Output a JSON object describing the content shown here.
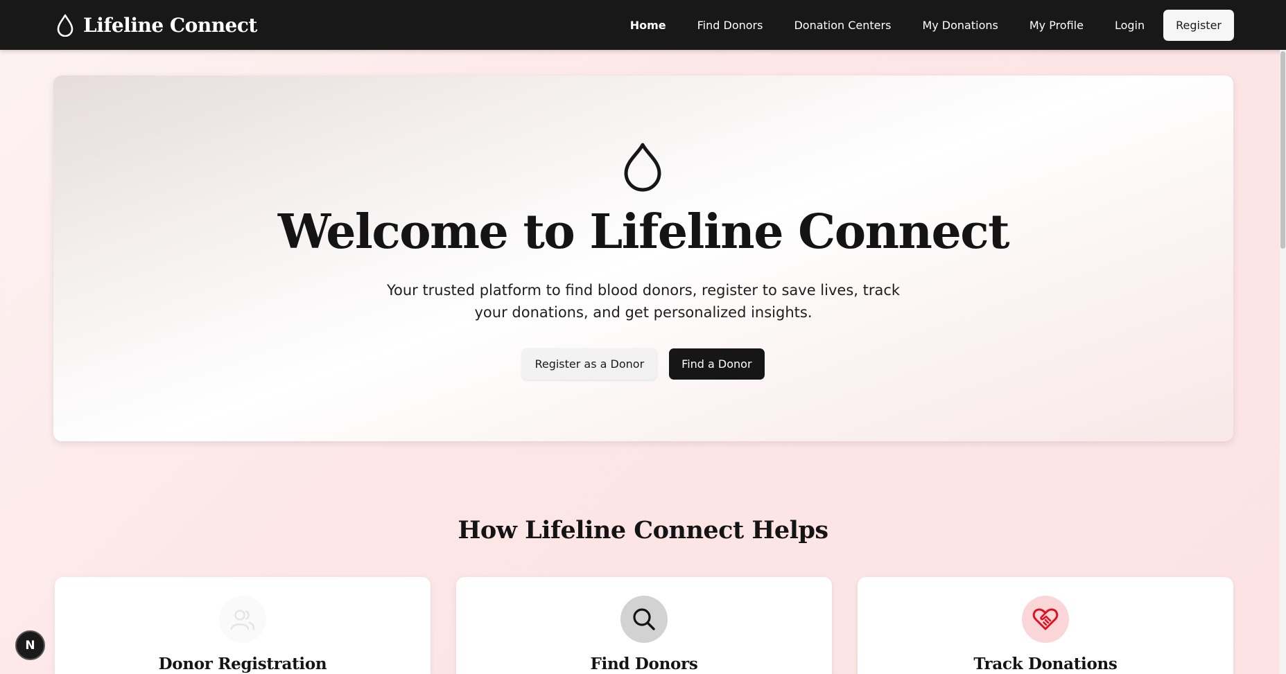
{
  "nav": {
    "brand": "Lifeline Connect",
    "links": [
      "Home",
      "Find Donors",
      "Donation Centers",
      "My Donations",
      "My Profile",
      "Login"
    ],
    "register": "Register"
  },
  "hero": {
    "title": "Welcome to Lifeline Connect",
    "subtitle": "Your trusted platform to find blood donors, register to save lives, track your donations, and get personalized insights.",
    "primary_button": "Register as a Donor",
    "secondary_button": "Find a Donor"
  },
  "section": {
    "title": "How Lifeline Connect Helps",
    "cards": [
      {
        "title": "Donor Registration",
        "icon": "users-icon"
      },
      {
        "title": "Find Donors",
        "icon": "search-icon"
      },
      {
        "title": "Track Donations",
        "icon": "heart-handshake-icon"
      }
    ]
  },
  "colors": {
    "navbar": "#181818",
    "accent_red": "#e0101e",
    "page_background": "#fde6e7"
  },
  "dev_badge": "N"
}
